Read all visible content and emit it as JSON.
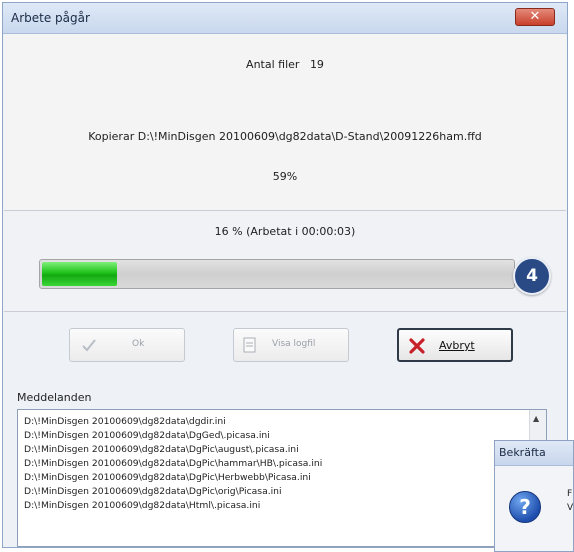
{
  "window": {
    "title": "Arbete pågår",
    "close_label": "✕"
  },
  "summary": {
    "file_count_label": "Antal filer",
    "file_count": "19",
    "copy_status": "Kopierar D:\\!MinDisgen 20100609\\dg82data\\D-Stand\\20091226ham.ffd",
    "file_percent": "59%"
  },
  "overall": {
    "status_text": "16 % (Arbetat i 00:00:03)",
    "progress_fraction": 0.16
  },
  "badge": {
    "number": "4",
    "color": "#2a4a86"
  },
  "buttons": {
    "ok_label": "Ok",
    "ok_icon": "check-icon",
    "log_label": "Visa logfil",
    "log_icon": "document-icon",
    "cancel_label": "Avbryt",
    "cancel_icon": "red-x-icon"
  },
  "messages": {
    "label": "Meddelanden",
    "lines": [
      "D:\\!MinDisgen 20100609\\dg82data\\dgdir.ini",
      "D:\\!MinDisgen 20100609\\dg82data\\DgGed\\.picasa.ini",
      "D:\\!MinDisgen 20100609\\dg82data\\DgPic\\august\\.picasa.ini",
      "D:\\!MinDisgen 20100609\\dg82data\\DgPic\\hammar\\HB\\.picasa.ini",
      "D:\\!MinDisgen 20100609\\dg82data\\DgPic\\Herbwebb\\Picasa.ini",
      "D:\\!MinDisgen 20100609\\dg82data\\DgPic\\orig\\Picasa.ini",
      "D:\\!MinDisgen 20100609\\dg82data\\Html\\.picasa.ini"
    ]
  },
  "confirm_dialog": {
    "title": "Bekräfta",
    "icon": "question-icon",
    "text_lines": [
      "F",
      "V"
    ]
  },
  "colors": {
    "progress_green": "#1fc21a",
    "cancel_x_red": "#c8202a",
    "badge_blue": "#2a4a86"
  }
}
